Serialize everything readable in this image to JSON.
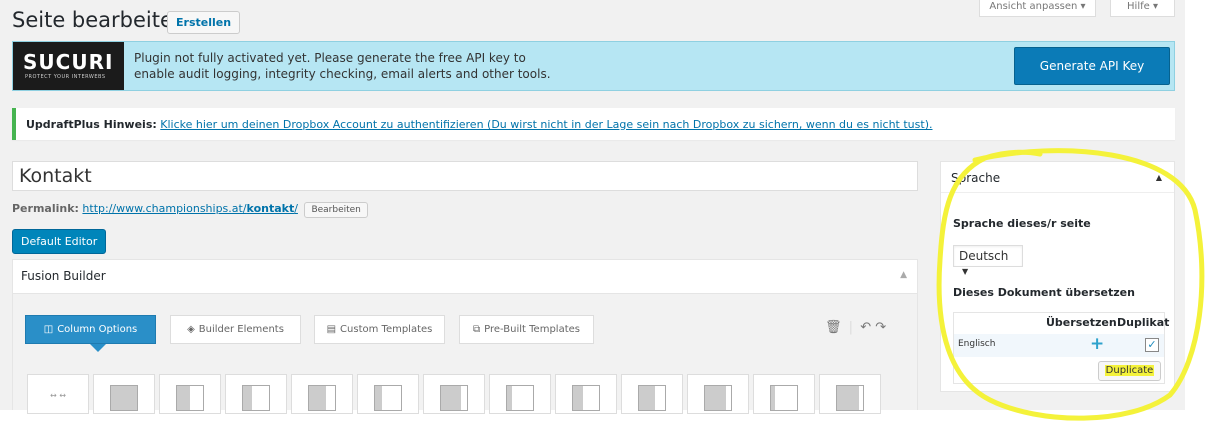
{
  "header": {
    "page_title": "Seite bearbeiten",
    "create_button": "Erstellen",
    "screen_options": "Ansicht anpassen ▾",
    "help": "Hilfe ▾"
  },
  "sucuri": {
    "logo": "SUCURI",
    "logo_tagline": "PROTECT YOUR INTERWEBS",
    "message_line1": "Plugin not fully activated yet. Please generate the free API key to",
    "message_line2": "enable audit logging, integrity checking, email alerts and other tools.",
    "generate_button": "Generate API Key"
  },
  "updraft": {
    "label": "UpdraftPlus Hinweis:",
    "link": "Klicke hier um deinen Dropbox Account zu authentifizieren (Du wirst nicht in der Lage sein nach Dropbox zu sichern, wenn du es nicht tust)."
  },
  "editor": {
    "title_value": "Kontakt",
    "permalink_label": "Permalink:",
    "permalink_base": "http://www.championships.at/",
    "permalink_slug": "kontakt",
    "permalink_trail": "/",
    "permalink_edit": "Bearbeiten",
    "default_editor_button": "Default Editor"
  },
  "fusion": {
    "title": "Fusion Builder",
    "tabs": [
      {
        "label": "Column Options",
        "icon": "columns-icon",
        "active": true
      },
      {
        "label": "Builder Elements",
        "icon": "layers-icon",
        "active": false
      },
      {
        "label": "Custom Templates",
        "icon": "file-icon",
        "active": false
      },
      {
        "label": "Pre-Built Templates",
        "icon": "copy-icon",
        "active": false
      }
    ],
    "first_column_label": "↔ ↔"
  },
  "sidebar": {
    "title": "Sprache",
    "language_label": "Sprache dieses/r seite",
    "language_selected": "Deutsch",
    "translate_label": "Dieses Dokument übersetzen",
    "col_translate": "Übersetzen",
    "col_duplicate": "Duplikat",
    "row_language": "Englisch",
    "duplicate_button": "Duplicate"
  },
  "colors": {
    "accent": "#0085ba",
    "sucuri_bg": "#b6e6f3",
    "highlight": "#f4f23a",
    "success": "#46b450"
  }
}
